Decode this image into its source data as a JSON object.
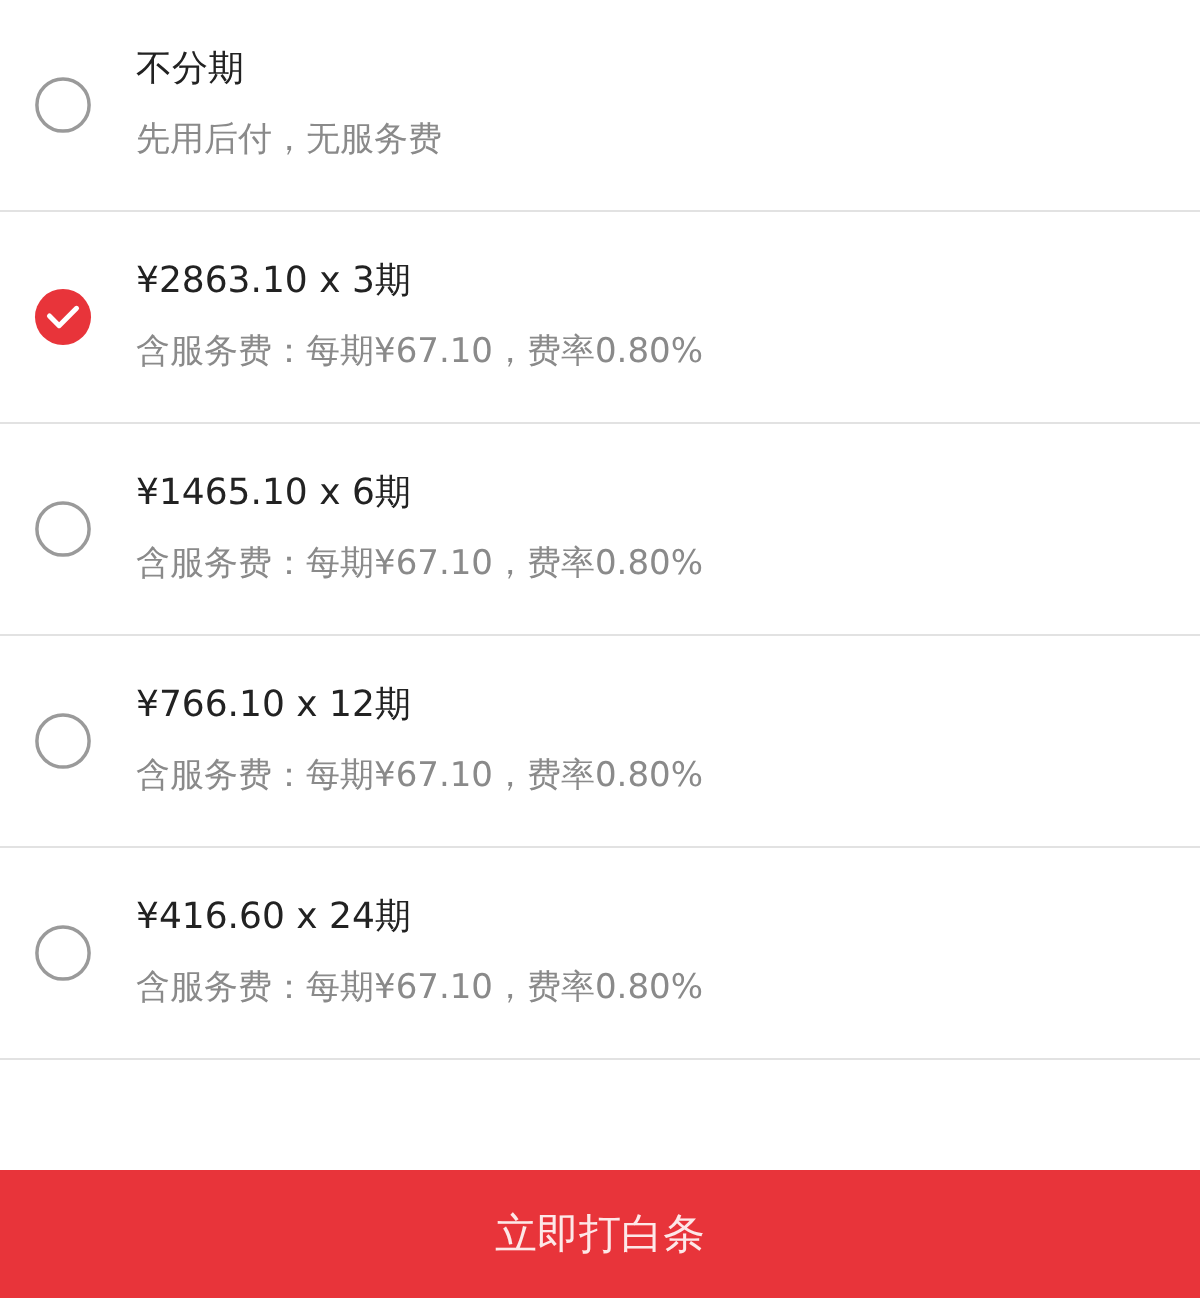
{
  "options": [
    {
      "title": "不分期",
      "subtitle": "先用后付，无服务费",
      "selected": false
    },
    {
      "title": "¥2863.10 x 3期",
      "subtitle": "含服务费：每期¥67.10，费率0.80%",
      "selected": true
    },
    {
      "title": "¥1465.10 x 6期",
      "subtitle": "含服务费：每期¥67.10，费率0.80%",
      "selected": false
    },
    {
      "title": "¥766.10 x 12期",
      "subtitle": "含服务费：每期¥67.10，费率0.80%",
      "selected": false
    },
    {
      "title": "¥416.60 x 24期",
      "subtitle": "含服务费：每期¥67.10，费率0.80%",
      "selected": false
    }
  ],
  "submit_button": "立即打白条"
}
